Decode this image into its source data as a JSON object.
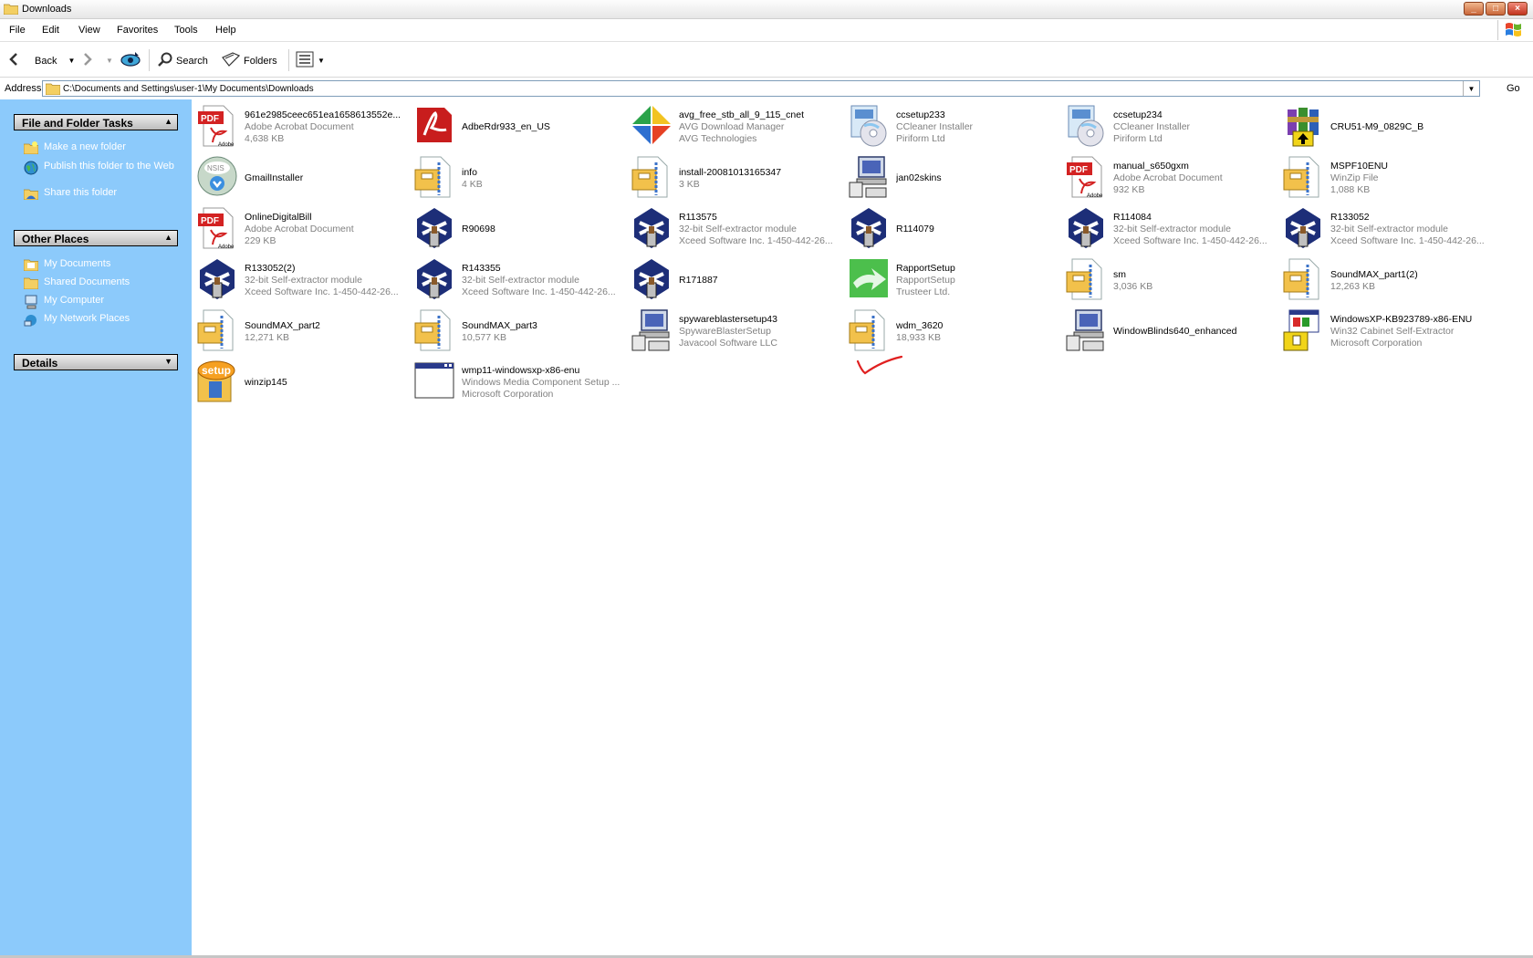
{
  "window": {
    "title": "Downloads"
  },
  "menu": [
    "File",
    "Edit",
    "View",
    "Favorites",
    "Tools",
    "Help"
  ],
  "toolbar": {
    "back": "Back",
    "search": "Search",
    "folders": "Folders"
  },
  "address": {
    "label": "Address",
    "path": "C:\\Documents and Settings\\user-1\\My Documents\\Downloads",
    "go": "Go"
  },
  "sidebar": {
    "tasks_title": "File and Folder Tasks",
    "tasks": [
      "Make a new folder",
      "Publish this folder to the Web",
      "Share this folder"
    ],
    "places_title": "Other Places",
    "places": [
      "My Documents",
      "Shared Documents",
      "My Computer",
      "My Network Places"
    ],
    "details_title": "Details"
  },
  "colors": {
    "sidebar": "#8ccafb",
    "link": "#ffffff",
    "detail_text": "#808080"
  },
  "files": [
    {
      "name": "961e2985ceec651ea1658613552e...",
      "l2": "Adobe Acrobat Document",
      "l3": "4,638 KB",
      "icon": "pdf-icon"
    },
    {
      "name": "AdbeRdr933_en_US",
      "l2": "",
      "l3": "",
      "icon": "adobe-reader-icon"
    },
    {
      "name": "avg_free_stb_all_9_115_cnet",
      "l2": "AVG Download Manager",
      "l3": "AVG Technologies",
      "icon": "avg-icon"
    },
    {
      "name": "ccsetup233",
      "l2": "CCleaner Installer",
      "l3": "Piriform Ltd",
      "icon": "installer-cd-icon"
    },
    {
      "name": "ccsetup234",
      "l2": "CCleaner Installer",
      "l3": "Piriform Ltd",
      "icon": "installer-cd-icon"
    },
    {
      "name": "CRU51-M9_0829C_B",
      "l2": "",
      "l3": "",
      "icon": "winrar-icon"
    },
    {
      "name": "GmailInstaller",
      "l2": "",
      "l3": "",
      "icon": "gmail-installer-icon"
    },
    {
      "name": "info",
      "l2": "4 KB",
      "l3": "",
      "icon": "zip-icon"
    },
    {
      "name": "install-20081013165347",
      "l2": "3 KB",
      "l3": "",
      "icon": "zip-icon"
    },
    {
      "name": "jan02skins",
      "l2": "",
      "l3": "",
      "icon": "setup-computer-icon"
    },
    {
      "name": "manual_s650gxm",
      "l2": "Adobe Acrobat Document",
      "l3": "932 KB",
      "icon": "pdf-icon"
    },
    {
      "name": "MSPF10ENU",
      "l2": "WinZip File",
      "l3": "1,088 KB",
      "icon": "zip-icon"
    },
    {
      "name": "OnlineDigitalBill",
      "l2": "Adobe Acrobat Document",
      "l3": "229 KB",
      "icon": "pdf-icon"
    },
    {
      "name": "R90698",
      "l2": "",
      "l3": "",
      "icon": "self-extractor-icon"
    },
    {
      "name": "R113575",
      "l2": "32-bit Self-extractor module",
      "l3": "Xceed Software Inc.   1-450-442-26...",
      "icon": "self-extractor-icon"
    },
    {
      "name": "R114079",
      "l2": "",
      "l3": "",
      "icon": "self-extractor-icon"
    },
    {
      "name": "R114084",
      "l2": "32-bit Self-extractor module",
      "l3": "Xceed Software Inc.   1-450-442-26...",
      "icon": "self-extractor-icon"
    },
    {
      "name": "R133052",
      "l2": "32-bit Self-extractor module",
      "l3": "Xceed Software Inc.   1-450-442-26...",
      "icon": "self-extractor-icon"
    },
    {
      "name": "R133052(2)",
      "l2": "32-bit Self-extractor module",
      "l3": "Xceed Software Inc.   1-450-442-26...",
      "icon": "self-extractor-icon"
    },
    {
      "name": "R143355",
      "l2": "32-bit Self-extractor module",
      "l3": "Xceed Software Inc.   1-450-442-26...",
      "icon": "self-extractor-icon"
    },
    {
      "name": "R171887",
      "l2": "",
      "l3": "",
      "icon": "self-extractor-icon"
    },
    {
      "name": "RapportSetup",
      "l2": "RapportSetup",
      "l3": "Trusteer Ltd.",
      "icon": "rapport-icon"
    },
    {
      "name": "sm",
      "l2": "3,036 KB",
      "l3": "",
      "icon": "zip-icon"
    },
    {
      "name": "SoundMAX_part1(2)",
      "l2": "12,263 KB",
      "l3": "",
      "icon": "zip-icon"
    },
    {
      "name": "SoundMAX_part2",
      "l2": "12,271 KB",
      "l3": "",
      "icon": "zip-icon"
    },
    {
      "name": "SoundMAX_part3",
      "l2": "10,577 KB",
      "l3": "",
      "icon": "zip-icon"
    },
    {
      "name": "spywareblastersetup43",
      "l2": "SpywareBlasterSetup",
      "l3": "Javacool Software LLC",
      "icon": "setup-computer-icon"
    },
    {
      "name": "wdm_3620",
      "l2": "18,933 KB",
      "l3": "",
      "icon": "zip-icon"
    },
    {
      "name": "WindowBlinds640_enhanced",
      "l2": "",
      "l3": "",
      "icon": "setup-computer-icon"
    },
    {
      "name": "WindowsXP-KB923789-x86-ENU",
      "l2": "Win32 Cabinet Self-Extractor",
      "l3": "Microsoft Corporation",
      "icon": "cabinet-extractor-icon"
    },
    {
      "name": "winzip145",
      "l2": "",
      "l3": "",
      "icon": "winzip-setup-icon"
    },
    {
      "name": "wmp11-windowsxp-x86-enu",
      "l2": "Windows Media Component Setup ...",
      "l3": "Microsoft Corporation",
      "icon": "window-app-icon"
    }
  ]
}
